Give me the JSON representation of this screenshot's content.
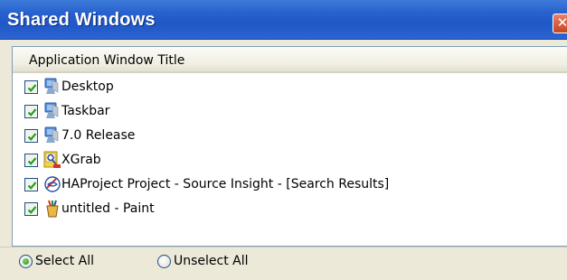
{
  "window": {
    "title": "Shared Windows",
    "close_glyph": "✕"
  },
  "list": {
    "column_header": "Application Window Title",
    "items": [
      {
        "label": "Desktop",
        "checked": true,
        "icon": "monitor-icon"
      },
      {
        "label": "Taskbar",
        "checked": true,
        "icon": "monitor-icon"
      },
      {
        "label": "7.0 Release",
        "checked": true,
        "icon": "monitor-icon"
      },
      {
        "label": "XGrab",
        "checked": true,
        "icon": "xgrab-app-icon"
      },
      {
        "label": "HAProject Project - Source Insight - [Search Results]",
        "checked": true,
        "icon": "source-insight-icon"
      },
      {
        "label": "untitled - Paint",
        "checked": true,
        "icon": "paint-icon"
      }
    ]
  },
  "footer": {
    "select_all_label": "Select All",
    "unselect_all_label": "Unselect All",
    "selected_option": "Select All"
  },
  "colors": {
    "titlebar": "#2a63cf",
    "dialog_bg": "#ece9d8",
    "checkmark": "#21a121",
    "list_border": "#7f9db9"
  }
}
